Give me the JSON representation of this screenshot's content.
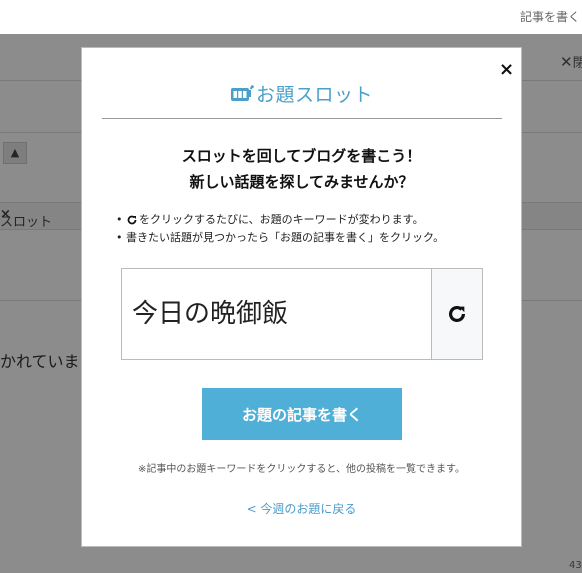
{
  "background": {
    "write_link": "記事を書く",
    "close_label": "閉",
    "up_label": "▲",
    "tag_label": "スロット",
    "body_text": "かれていま",
    "count": "43"
  },
  "modal": {
    "close": "×",
    "title": "お題スロット",
    "headline_line1": "スロットを回してブログを書こう！",
    "headline_line2": "新しい話題を探してみませんか？",
    "note1": "をクリックするたびに、お題のキーワードが変わります。",
    "note2": "書きたい話題が見つかったら「お題の記事を書く」をクリック。",
    "slot_word": "今日の晩御飯",
    "write_button": "お題の記事を書く",
    "footnote": "※記事中のお題キーワードをクリックすると、他の投稿を一覧できます。",
    "back_link": "< 今週のお題に戻る"
  },
  "colors": {
    "accent": "#4fafd6",
    "link": "#4a9ccc",
    "overlay": "rgba(0,0,0,0.45)"
  },
  "icons": {
    "logo": "slot-machine-icon",
    "refresh": "refresh-icon",
    "close": "close-icon"
  }
}
